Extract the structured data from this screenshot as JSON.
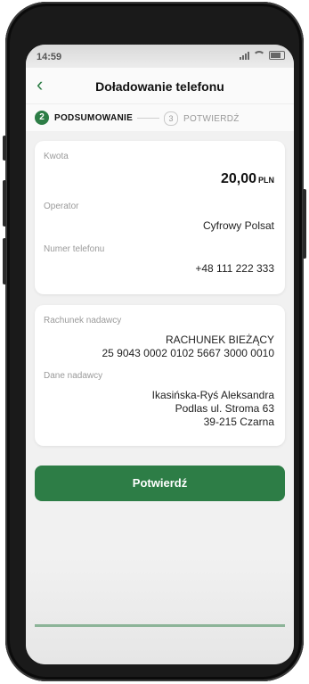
{
  "status_bar": {
    "time": "14:59"
  },
  "header": {
    "back_icon": "chevron-left-icon",
    "title": "Doładowanie telefonu"
  },
  "steps": [
    {
      "number": "2",
      "label": "PODSUMOWANIE",
      "active": true
    },
    {
      "number": "3",
      "label": "POTWIERDŹ",
      "active": false
    }
  ],
  "summary_card": {
    "amount_label": "Kwota",
    "amount_value": "20,00",
    "amount_currency": "PLN",
    "operator_label": "Operator",
    "operator_value": "Cyfrowy Polsat",
    "phone_label": "Numer telefonu",
    "phone_value": "+48 111 222 333"
  },
  "sender_card": {
    "account_label": "Rachunek nadawcy",
    "account_name": "RACHUNEK BIEŻĄCY",
    "account_number": "25 9043 0002 0102 5667 3000 0010",
    "sender_label": "Dane nadawcy",
    "sender_name": "Ikasińska-Ryś Aleksandra",
    "sender_street": "Podlas ul. Stroma 63",
    "sender_city": "39-215 Czarna"
  },
  "actions": {
    "confirm_label": "Potwierdź"
  },
  "colors": {
    "accent": "#2d7d46",
    "background": "#f1f1f1"
  }
}
